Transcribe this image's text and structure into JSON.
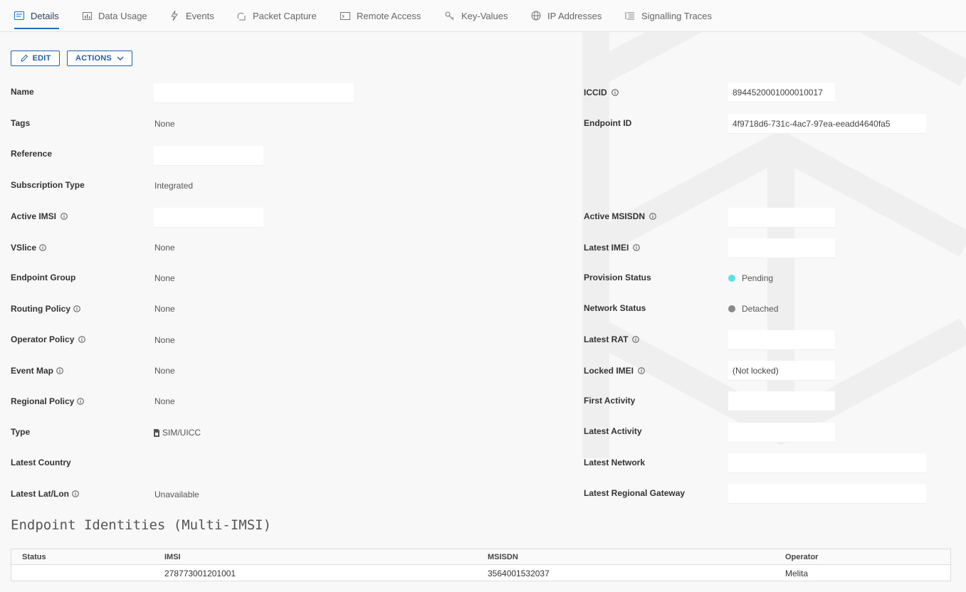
{
  "tabs": [
    {
      "label": "Details",
      "icon": "details-icon",
      "active": true
    },
    {
      "label": "Data Usage",
      "icon": "chart-icon"
    },
    {
      "label": "Events",
      "icon": "lightning-icon"
    },
    {
      "label": "Packet Capture",
      "icon": "capture-icon"
    },
    {
      "label": "Remote Access",
      "icon": "terminal-icon"
    },
    {
      "label": "Key-Values",
      "icon": "key-icon"
    },
    {
      "label": "IP Addresses",
      "icon": "globe-icon"
    },
    {
      "label": "Signalling Traces",
      "icon": "list-icon"
    }
  ],
  "toolbar": {
    "edit_label": "EDIT",
    "actions_label": "ACTIONS"
  },
  "left_fields": {
    "name": {
      "label": "Name",
      "value": ""
    },
    "tags": {
      "label": "Tags",
      "value": "None"
    },
    "reference": {
      "label": "Reference",
      "value": ""
    },
    "subscription_type": {
      "label": "Subscription Type",
      "value": "Integrated"
    },
    "active_imsi": {
      "label": "Active IMSI",
      "value": ""
    },
    "vslice": {
      "label": "VSlice",
      "value": "None"
    },
    "endpoint_group": {
      "label": "Endpoint Group",
      "value": "None"
    },
    "routing_policy": {
      "label": "Routing Policy",
      "value": "None"
    },
    "operator_policy": {
      "label": "Operator Policy",
      "value": "None"
    },
    "event_map": {
      "label": "Event Map",
      "value": "None"
    },
    "regional_policy": {
      "label": "Regional Policy",
      "value": "None"
    },
    "type": {
      "label": "Type",
      "value": "SIM/UICC"
    },
    "latest_country": {
      "label": "Latest Country",
      "value": ""
    },
    "latest_lat_lon": {
      "label": "Latest Lat/Lon",
      "value": "Unavailable"
    }
  },
  "right_fields": {
    "iccid": {
      "label": "ICCID",
      "value": "8944520001000010017"
    },
    "endpoint_id": {
      "label": "Endpoint ID",
      "value": "4f9718d6-731c-4ac7-97ea-eeadd4640fa5"
    },
    "active_msisdn": {
      "label": "Active MSISDN",
      "value": ""
    },
    "latest_imei": {
      "label": "Latest IMEI",
      "value": ""
    },
    "provision_status": {
      "label": "Provision Status",
      "value": "Pending",
      "color": "#5ce1e6"
    },
    "network_status": {
      "label": "Network Status",
      "value": "Detached",
      "color": "#8a8a8a"
    },
    "latest_rat": {
      "label": "Latest RAT",
      "value": ""
    },
    "locked_imei": {
      "label": "Locked IMEI",
      "value": "(Not locked)"
    },
    "first_activity": {
      "label": "First Activity",
      "value": ""
    },
    "latest_activity": {
      "label": "Latest Activity",
      "value": ""
    },
    "latest_network": {
      "label": "Latest Network",
      "value": ""
    },
    "latest_regional_gateway": {
      "label": "Latest Regional Gateway",
      "value": ""
    }
  },
  "identities": {
    "title": "Endpoint Identities (Multi-IMSI)",
    "columns": [
      "Status",
      "IMSI",
      "MSISDN",
      "Operator"
    ],
    "rows": [
      {
        "status": "",
        "imsi": "278773001201001",
        "msisdn": "3564001532037",
        "operator": "Melita"
      }
    ]
  },
  "colors": {
    "accent": "#1f5fa8",
    "pending": "#5ce1e6",
    "detached": "#8a8a8a"
  }
}
